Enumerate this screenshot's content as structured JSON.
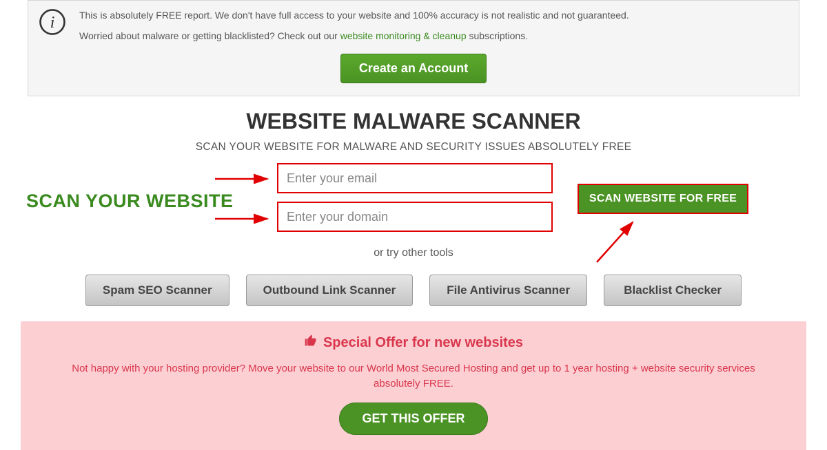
{
  "info": {
    "line1": "This is absolutely FREE report. We don't have full access to your website and 100% accuracy is not realistic and not guaranteed.",
    "line2_pre": "Worried about malware or getting blacklisted? Check out our ",
    "line2_link": "website monitoring & cleanup",
    "line2_post": " subscriptions.",
    "cta": "Create an Account"
  },
  "headline": "WEBSITE MALWARE SCANNER",
  "subhead": "SCAN YOUR WEBSITE FOR MALWARE AND SECURITY ISSUES ABSOLUTELY FREE",
  "form": {
    "side_label": "SCAN YOUR WEBSITE",
    "email_placeholder": "Enter your email",
    "domain_placeholder": "Enter your domain",
    "scan_button": "SCAN WEBSITE FOR FREE",
    "or_try": "or try other tools"
  },
  "tools": {
    "t1": "Spam SEO Scanner",
    "t2": "Outbound Link Scanner",
    "t3": "File Antivirus Scanner",
    "t4": "Blacklist Checker"
  },
  "offer": {
    "title": "Special Offer for new websites",
    "desc": "Not happy with your hosting provider? Move your website to our World Most Secured Hosting and get up to 1 year hosting + website security services absolutely FREE.",
    "cta": "GET THIS OFFER"
  },
  "colors": {
    "highlight_red": "#e00000",
    "brand_green": "#4b9324",
    "alert_red": "#d9364c"
  }
}
